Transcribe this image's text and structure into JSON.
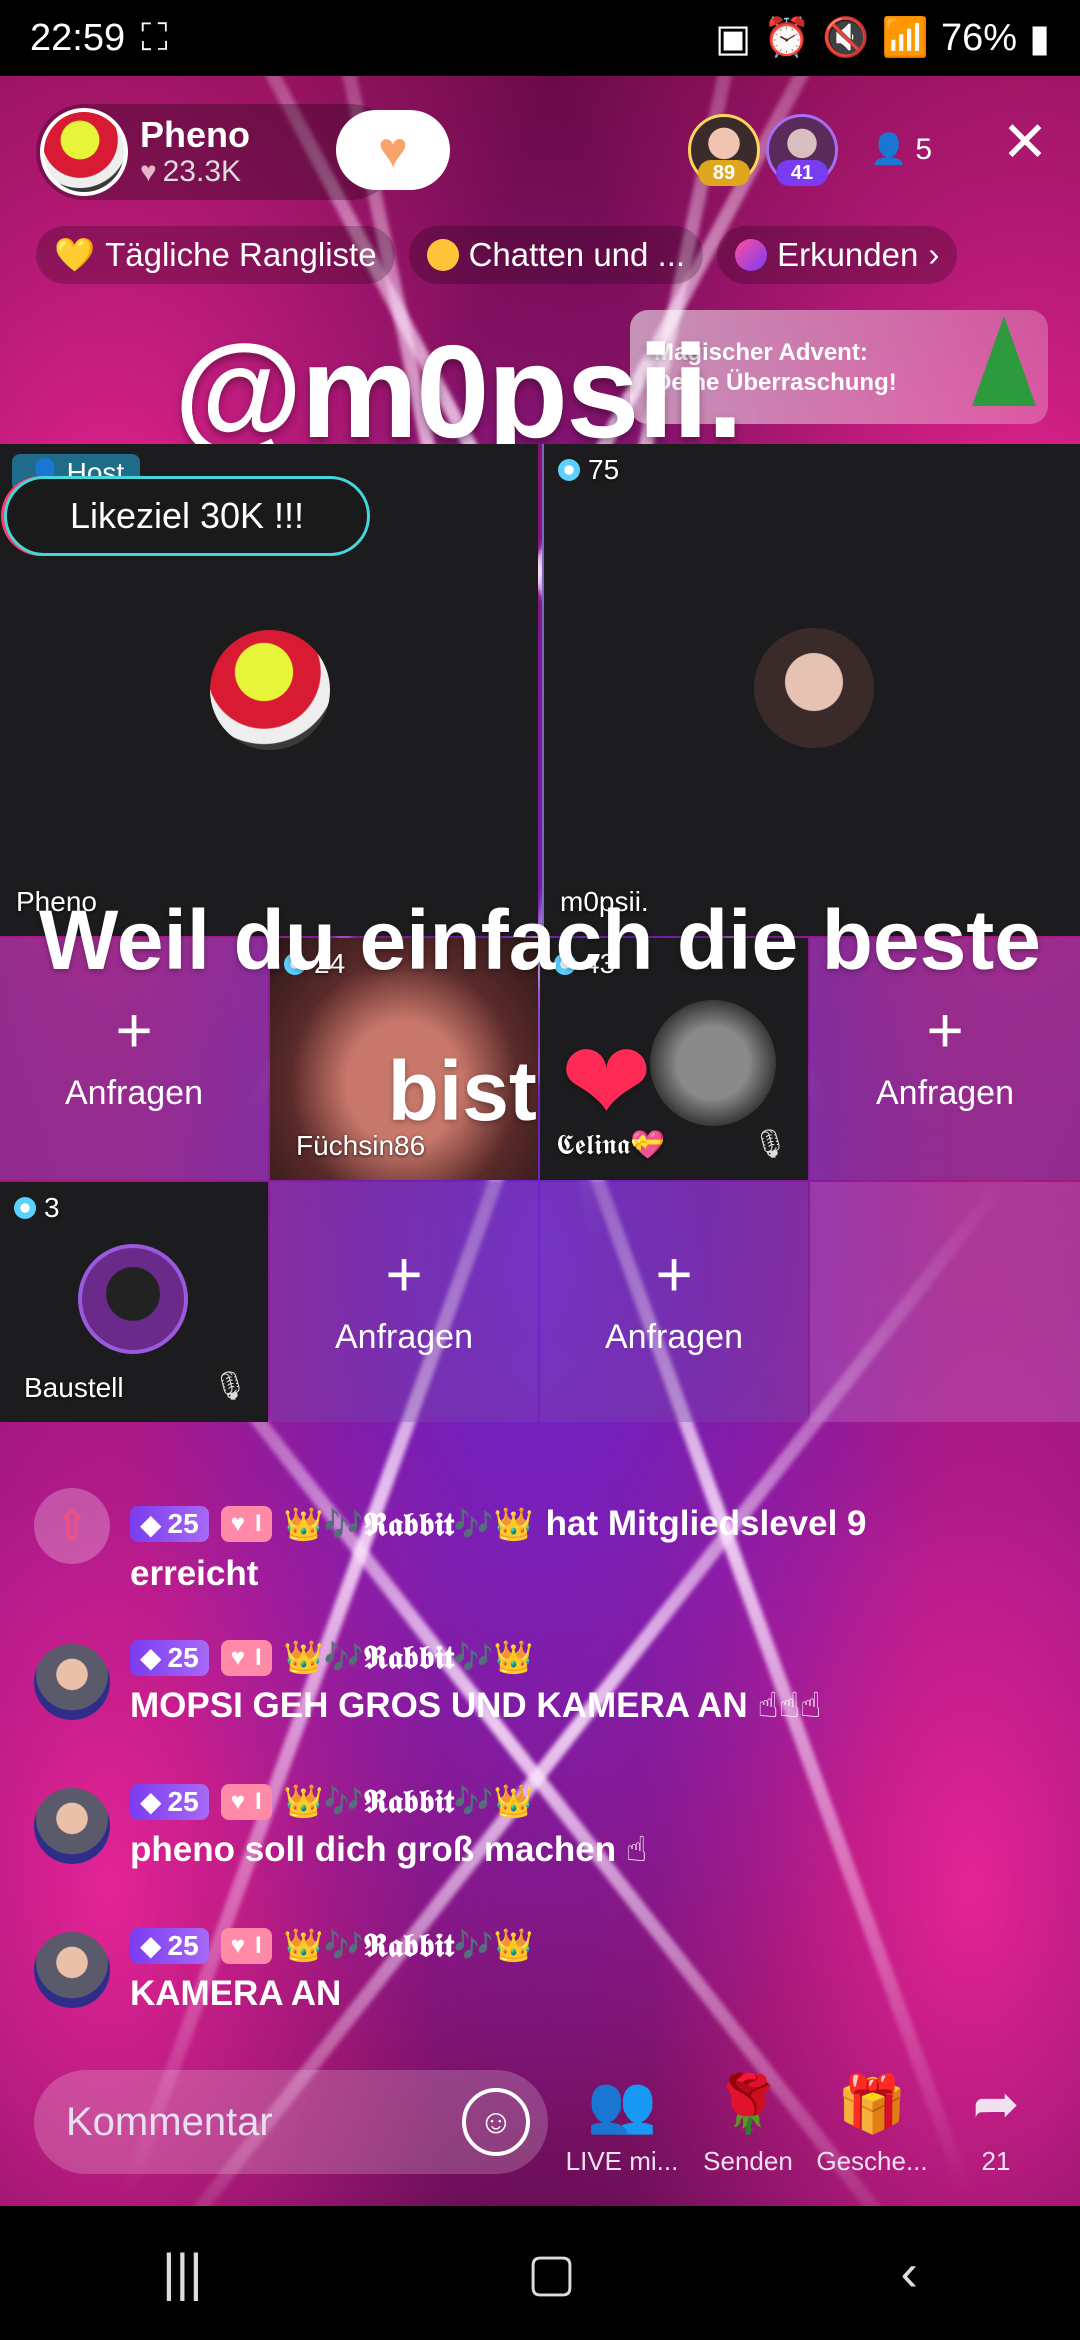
{
  "status_bar": {
    "time": "22:59",
    "battery": "76%"
  },
  "header": {
    "host_name": "Pheno",
    "host_likes": "23.3K",
    "viewers": [
      {
        "badge": "89",
        "badge_color": "#e0a71e"
      },
      {
        "badge": "41",
        "badge_color": "#7a3cf0"
      }
    ],
    "viewer_count": "5"
  },
  "pills": [
    {
      "label": "Tägliche Rangliste",
      "color": "#ffc43a"
    },
    {
      "label": "Chatten und ...",
      "color": "#ffc43a"
    },
    {
      "label": "Erkunden",
      "color": "#ff4fa0"
    }
  ],
  "overlay": {
    "handle": "@m0psii.",
    "promo_line1": "Magischer Advent:",
    "promo_line2": "Deine Überraschung!",
    "caption_line1": "Weil du einfach die beste",
    "caption_line2": "bist",
    "heart": "❤"
  },
  "grid": {
    "host_tag": "Host",
    "like_goal": "Likeziel 30K !!!",
    "host_name": "Pheno",
    "guest_name": "m0psii.",
    "guest_score": "75",
    "add_label": "Anfragen",
    "fuechsin_name": "Füchsin86",
    "fuechsin_score": "24",
    "celina_name": "𝕮𝖊𝖑𝖎𝖓𝖆💝",
    "celina_score": "43",
    "baustell_name": "Baustell",
    "baustell_score": "3"
  },
  "chat": [
    {
      "level": "25",
      "user": "👑🎶𝕽𝖆𝖇𝖇𝖎𝖙🎶👑",
      "suffix": "hat Mitgliedslevel 9",
      "text": "erreicht"
    },
    {
      "level": "25",
      "user": "👑🎶𝕽𝖆𝖇𝖇𝖎𝖙🎶👑",
      "text": "MOPSI GEH GROS UND KAMERA AN ☝☝☝"
    },
    {
      "level": "25",
      "user": "👑🎶𝕽𝖆𝖇𝖇𝖎𝖙🎶👑",
      "text": "pheno soll dich groß machen ☝"
    },
    {
      "level": "25",
      "user": "👑🎶𝕽𝖆𝖇𝖇𝖎𝖙🎶👑",
      "text": "KAMERA AN"
    }
  ],
  "bottom": {
    "comment_placeholder": "Kommentar",
    "live_label": "LIVE mi...",
    "send_label": "Senden",
    "gift_label": "Gesche...",
    "share_count": "21"
  },
  "icons": {
    "close": "close-icon",
    "share": "share-icon",
    "gift": "gift-icon",
    "rose": "rose-icon",
    "live_with": "people-icon"
  }
}
